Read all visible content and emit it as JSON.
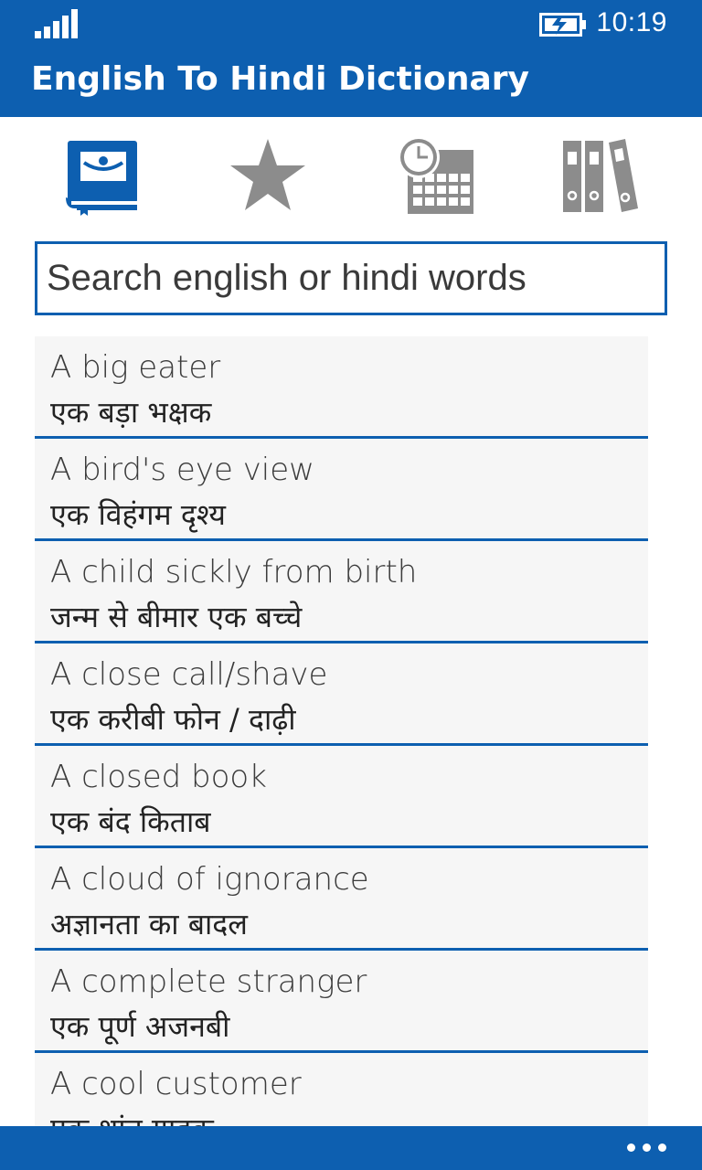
{
  "status": {
    "time": "10:19",
    "signal_icon": "signal-bars-icon",
    "battery_icon": "battery-charging-icon"
  },
  "app": {
    "title": "English To Hindi Dictionary"
  },
  "tabs": [
    {
      "icon": "dictionary-book-icon",
      "active": true
    },
    {
      "icon": "star-icon",
      "active": false
    },
    {
      "icon": "history-calendar-clock-icon",
      "active": false
    },
    {
      "icon": "binders-icon",
      "active": false
    }
  ],
  "search": {
    "placeholder": "Search english or hindi words",
    "value": ""
  },
  "entries": [
    {
      "en": "A big eater",
      "hi": "एक बड़ा भक्षक"
    },
    {
      "en": "A bird's eye view",
      "hi": "एक विहंगम दृश्य"
    },
    {
      "en": "A child sickly from birth",
      "hi": "जन्म से बीमार एक बच्चे"
    },
    {
      "en": "A close call/shave",
      "hi": "एक करीबी फोन / दाढ़ी"
    },
    {
      "en": "A closed book",
      "hi": "एक बंद किताब"
    },
    {
      "en": "A cloud of ignorance",
      "hi": "अज्ञानता का बादल"
    },
    {
      "en": "A complete stranger",
      "hi": "एक पूर्ण अजनबी"
    },
    {
      "en": "A cool customer",
      "hi": "एक शांत ग्राहक"
    }
  ],
  "appbar": {
    "more_icon": "more-dots-icon"
  },
  "colors": {
    "accent": "#0d5fb0",
    "inactive_icon": "#8c8c8c",
    "row_bg": "#f6f6f6"
  }
}
